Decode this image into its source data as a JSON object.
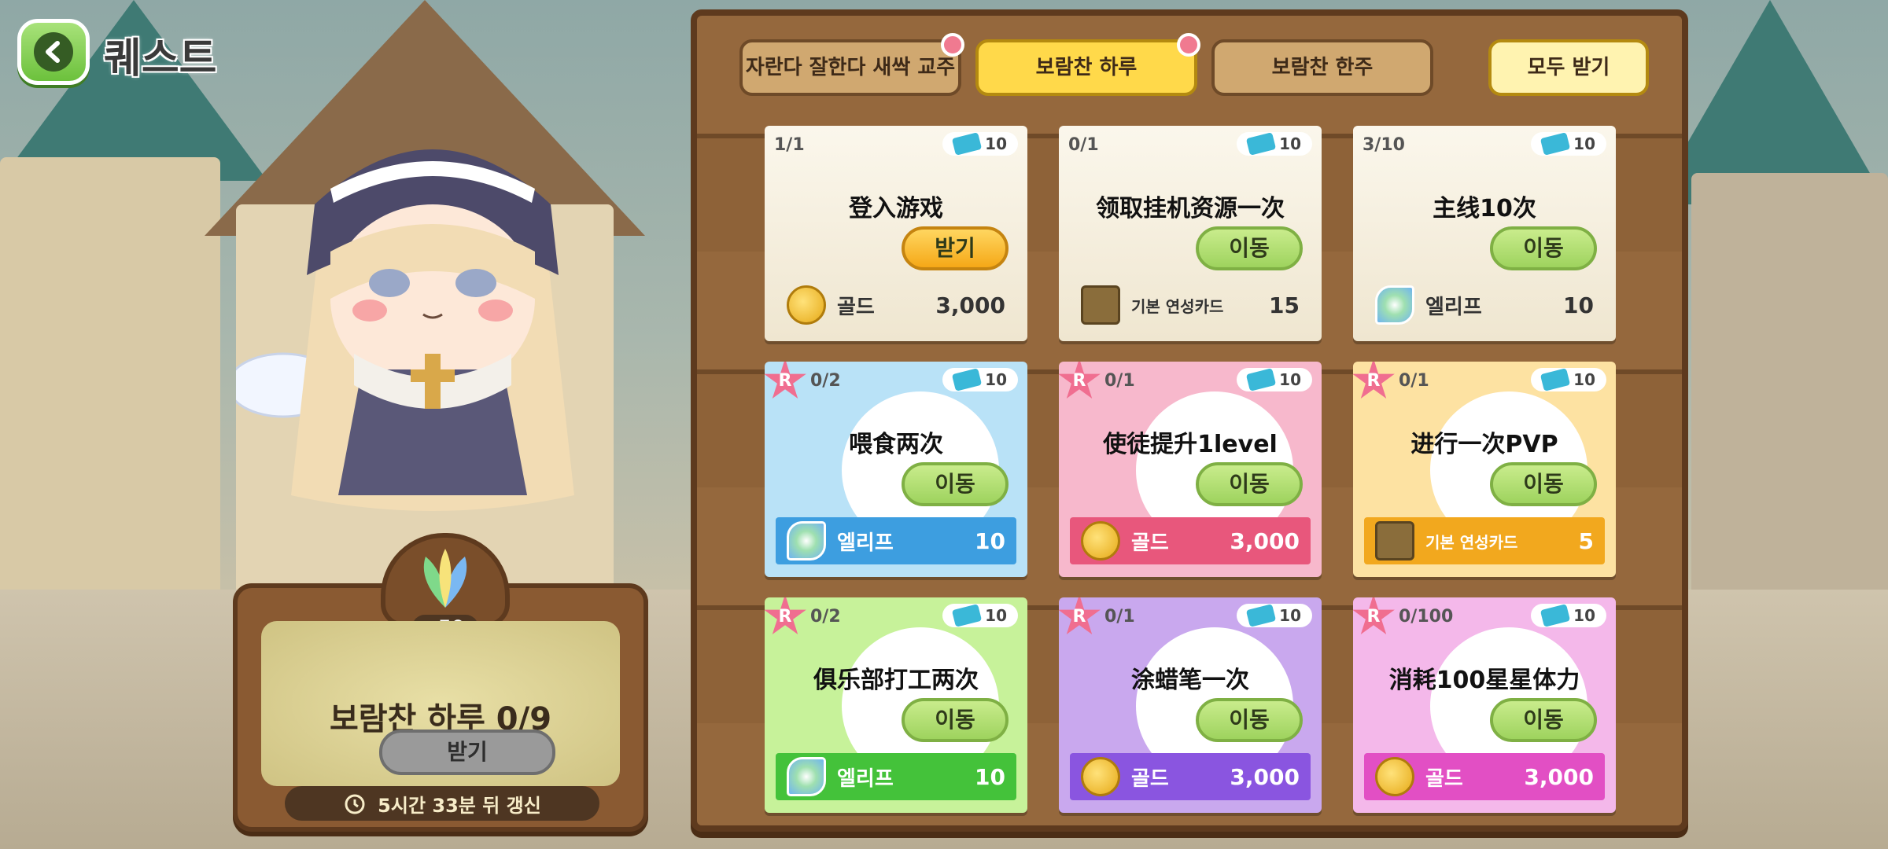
{
  "header": {
    "title": "퀘스트",
    "back_icon": "back-arrow-icon"
  },
  "tabs": [
    {
      "label": "자란다 잘한다 새싹 교주",
      "selected": false,
      "badge": "flower-icon"
    },
    {
      "label": "보람찬 하루",
      "selected": true,
      "badge": "flower-icon"
    },
    {
      "label": "보람찬 한주",
      "selected": false
    }
  ],
  "claim_all_label": "모두 받기",
  "reward_panel": {
    "count": "x50",
    "title": "보람찬 하루 0/9",
    "claim_label": "받기",
    "timer": "5시간 33분 뒤 갱신",
    "icon": "elif-leaf-icon",
    "timer_icon": "alarm-clock-icon"
  },
  "quests": [
    {
      "progress": "1/1",
      "tickets": "10",
      "title": "登入游戏",
      "button": "받기",
      "reward_name": "골드",
      "reward_amount": "3,000",
      "reward_icon": "gold-coin-icon"
    },
    {
      "progress": "0/1",
      "tickets": "10",
      "title": "领取挂机资源一次",
      "button": "이동",
      "reward_name": "기본 연성카드",
      "reward_amount": "15",
      "reward_icon": "card-icon"
    },
    {
      "progress": "3/10",
      "tickets": "10",
      "title": "主线10次",
      "button": "이동",
      "reward_name": "엘리프",
      "reward_amount": "10",
      "reward_icon": "elif-leaf-icon"
    },
    {
      "rank": "R",
      "progress": "0/2",
      "tickets": "10",
      "title": "喂食两次",
      "button": "이동",
      "reward_name": "엘리프",
      "reward_amount": "10",
      "reward_icon": "elif-leaf-icon"
    },
    {
      "rank": "R",
      "progress": "0/1",
      "tickets": "10",
      "title": "使徒提升1level",
      "button": "이동",
      "reward_name": "골드",
      "reward_amount": "3,000",
      "reward_icon": "gold-coin-icon"
    },
    {
      "rank": "R",
      "progress": "0/1",
      "tickets": "10",
      "title": "进行一次PVP",
      "button": "이동",
      "reward_name": "기본 연성카드",
      "reward_amount": "5",
      "reward_icon": "card-icon"
    },
    {
      "rank": "R",
      "progress": "0/2",
      "tickets": "10",
      "title": "俱乐部打工两次",
      "button": "이동",
      "reward_name": "엘리프",
      "reward_amount": "10",
      "reward_icon": "elif-leaf-icon"
    },
    {
      "rank": "R",
      "progress": "0/1",
      "tickets": "10",
      "title": "涂蜡笔一次",
      "button": "이동",
      "reward_name": "골드",
      "reward_amount": "3,000",
      "reward_icon": "gold-coin-icon"
    },
    {
      "rank": "R",
      "progress": "0/100",
      "tickets": "10",
      "title": "消耗100星星体力",
      "button": "이동",
      "reward_name": "골드",
      "reward_amount": "3,000",
      "reward_icon": "gold-coin-icon"
    }
  ],
  "colors": {
    "card_blue": "#b9e2f7",
    "card_pink": "#f7b8cc",
    "card_yellow": "#fde2a2",
    "card_green": "#c7f29a",
    "card_purple": "#c9a8ee",
    "card_magenta": "#f4b8ea"
  }
}
